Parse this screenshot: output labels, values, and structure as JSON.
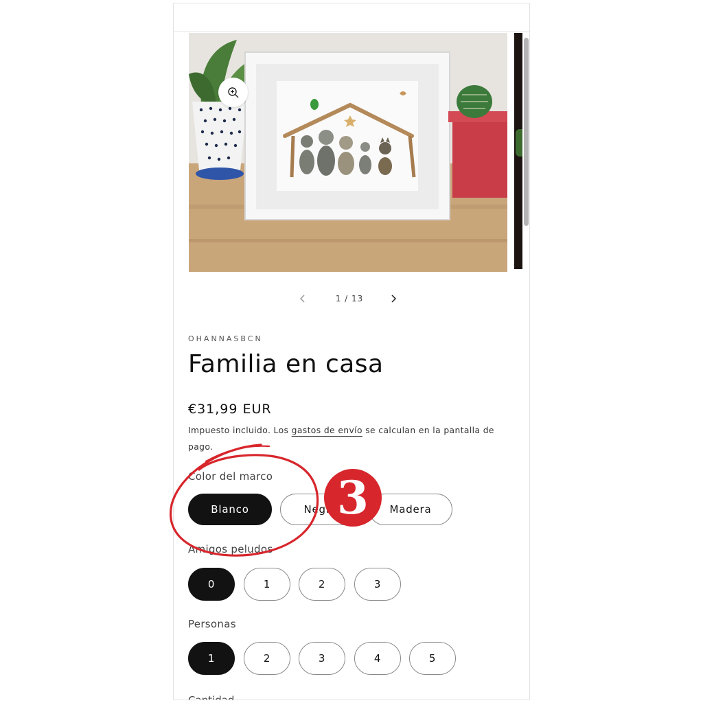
{
  "gallery": {
    "zoom_icon": "zoom-in-icon",
    "pager_text": "1 / 13",
    "prev_icon": "chevron-left-icon",
    "next_icon": "chevron-right-icon"
  },
  "product": {
    "vendor": "OHANNASBCN",
    "title": "Familia en casa",
    "price": "€31,99 EUR",
    "tax_before": "Impuesto incluido. Los ",
    "tax_link": "gastos de envío",
    "tax_after": " se calculan en la pantalla de pago."
  },
  "options": {
    "frame_color": {
      "label": "Color del marco",
      "values": [
        "Blanco",
        "Negro",
        "Madera"
      ],
      "selected": "Blanco"
    },
    "pets": {
      "label": "Amigos peludos",
      "values": [
        "0",
        "1",
        "2",
        "3"
      ],
      "selected": "0"
    },
    "people": {
      "label": "Personas",
      "values": [
        "1",
        "2",
        "3",
        "4",
        "5"
      ],
      "selected": "1"
    },
    "quantity_label": "Cantidad"
  },
  "annotation": {
    "step_number": "3",
    "color": "#d7262c"
  },
  "colors": {
    "selected_pill": "#121212",
    "pill_border": "#8a8a8a"
  }
}
